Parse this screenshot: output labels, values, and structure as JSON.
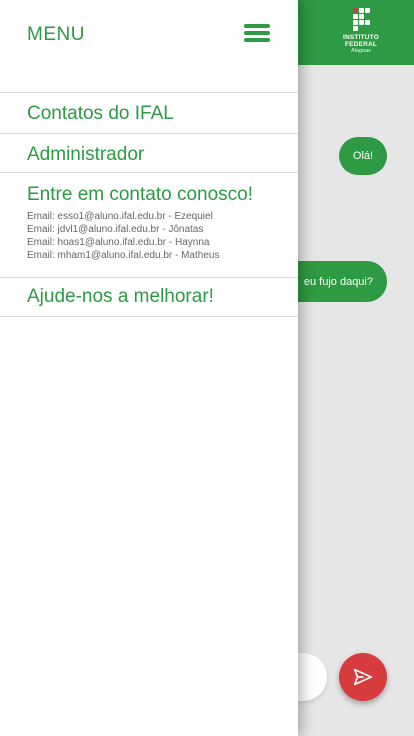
{
  "colors": {
    "brand_green": "#2e9a43",
    "send_red": "#d63b3e"
  },
  "header": {
    "logo": {
      "line1": "INSTITUTO",
      "line2": "FEDERAL",
      "line3": "Alagoas"
    }
  },
  "chat": {
    "messages": [
      {
        "text": "Olá!"
      },
      {
        "text": "eu fujo daqui?"
      }
    ],
    "send_icon": "send-icon"
  },
  "drawer": {
    "title": "MENU",
    "menu_icon": "hamburger-icon",
    "items": [
      {
        "label": "Contatos do IFAL"
      },
      {
        "label": "Administrador"
      },
      {
        "label": "Entre em contato conosco!",
        "emails": [
          "Email: esso1@aluno.ifal.edu.br - Ezequiel",
          "Email: jdvl1@aluno.ifal.edu.br - Jônatas",
          "Email: hoas1@aluno.ifal.edu.br - Haynna",
          "Email: mham1@aluno.ifal.edu.br - Matheus"
        ]
      },
      {
        "label": "Ajude-nos a melhorar!"
      }
    ]
  }
}
